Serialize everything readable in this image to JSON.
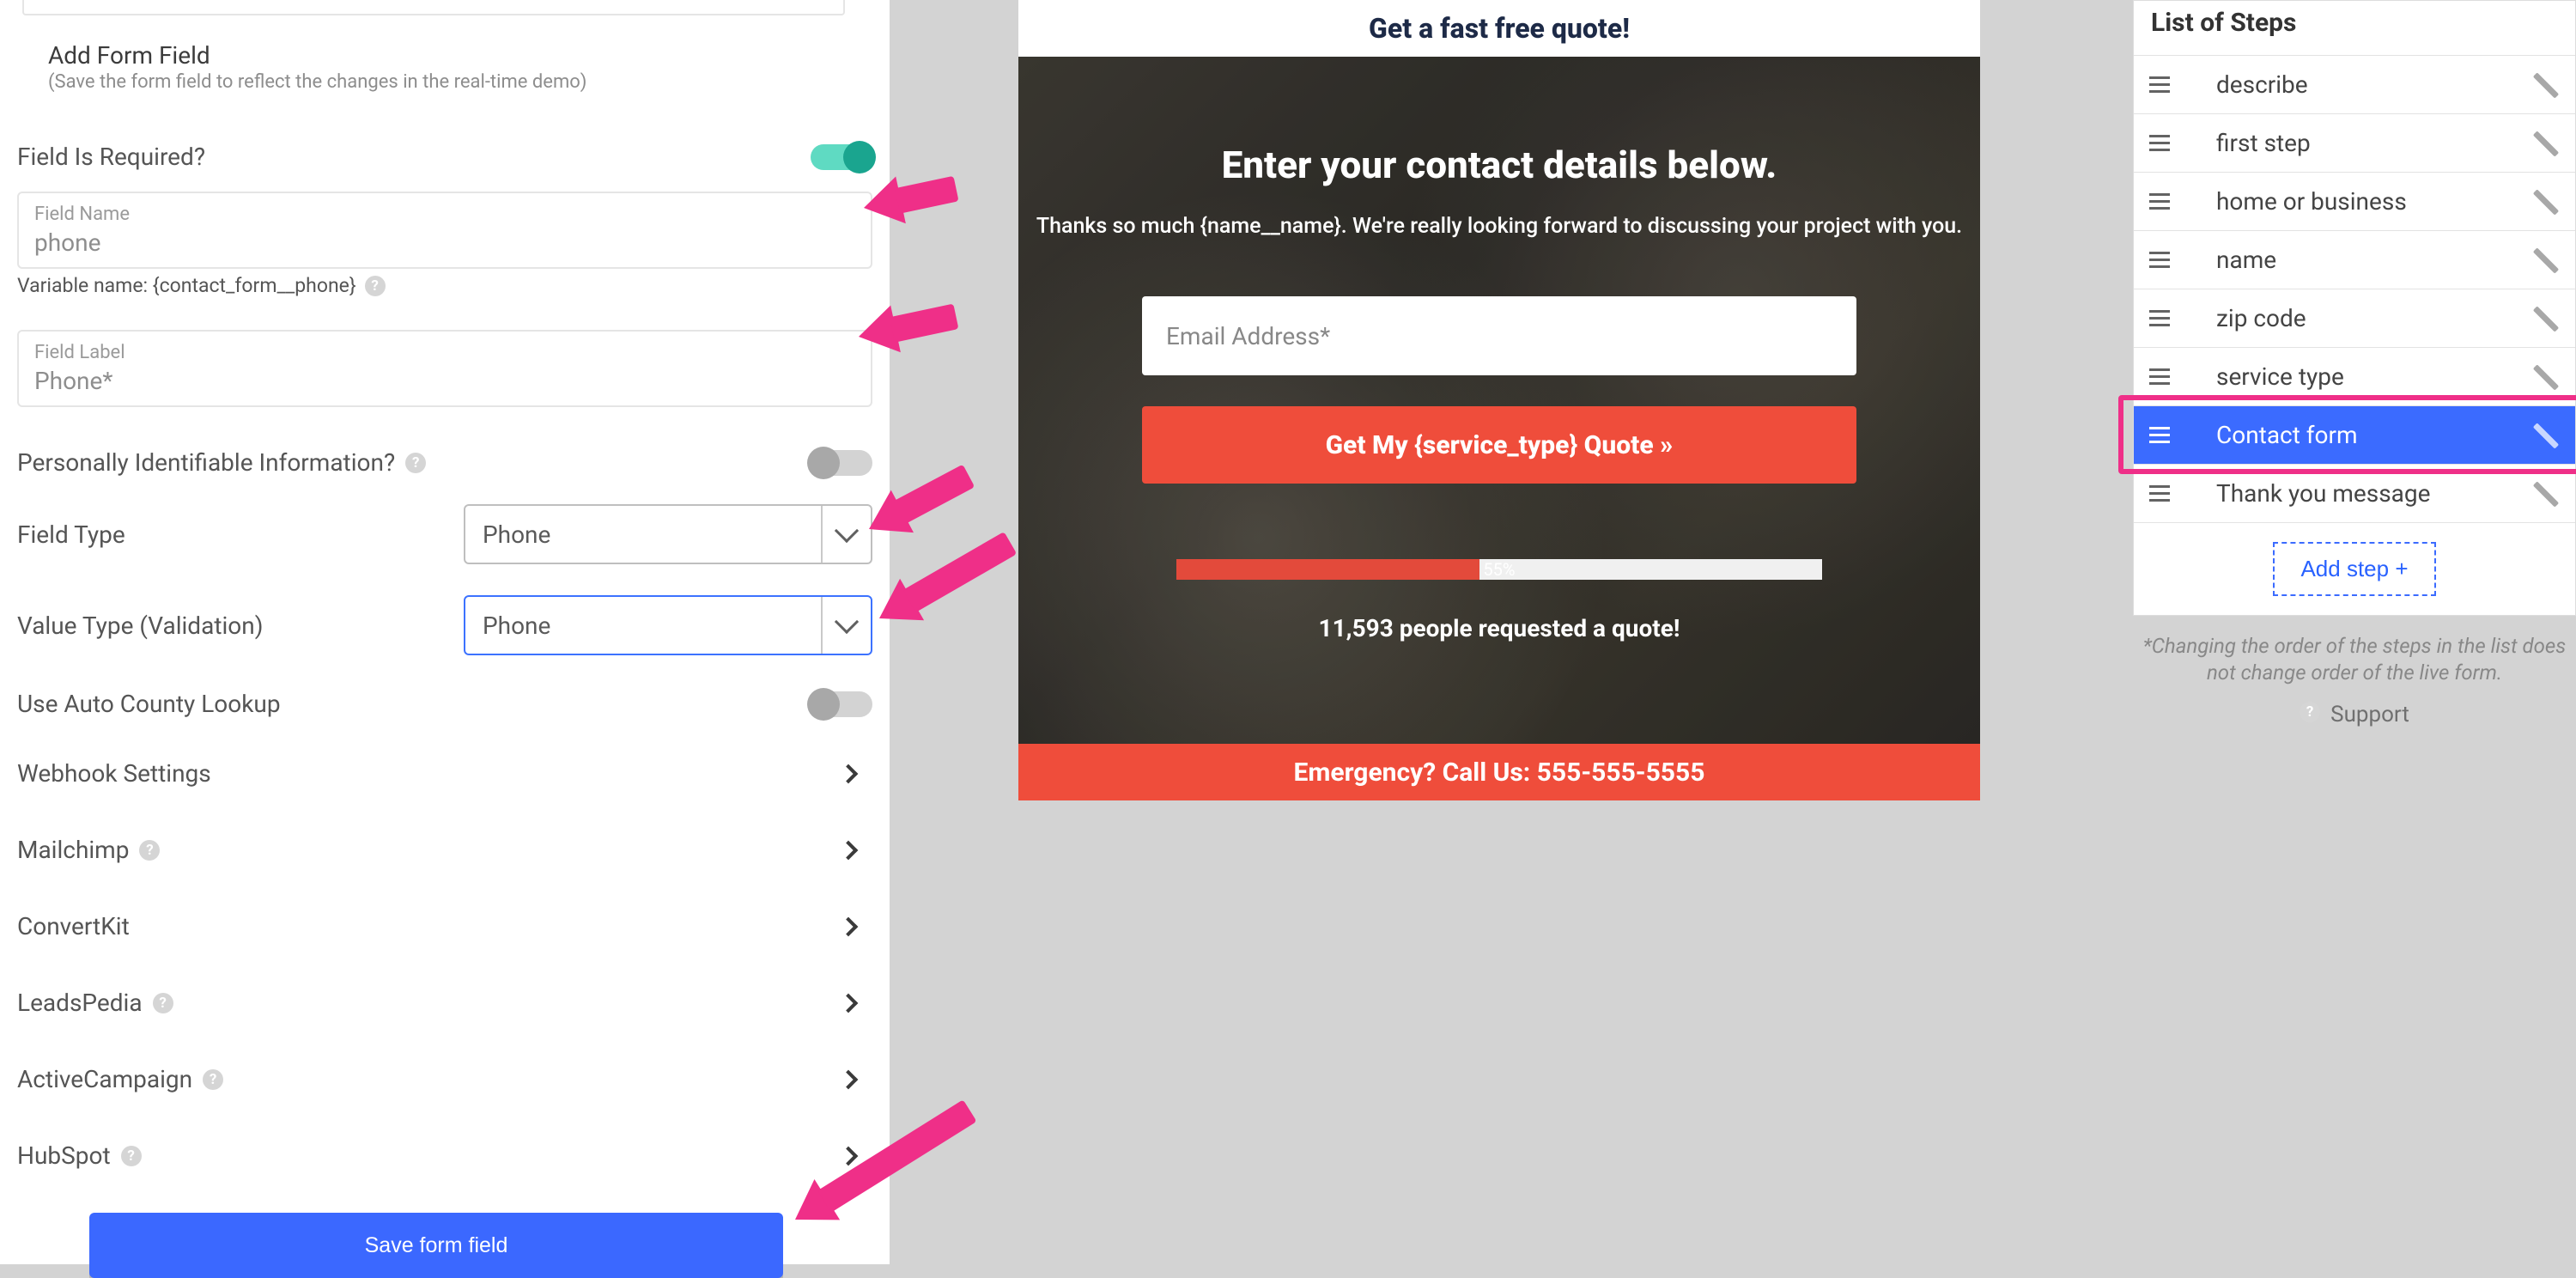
{
  "leftPanel": {
    "sectionTitle": "Add Form Field",
    "sectionSub": "(Save the form field to reflect the changes in the real-time demo)",
    "requiredLabel": "Field Is Required?",
    "requiredOn": true,
    "fieldName": {
      "label": "Field Name",
      "value": "phone"
    },
    "variableName": "Variable name: {contact_form__phone}",
    "fieldLabel": {
      "label": "Field Label",
      "value": "Phone*"
    },
    "piiLabel": "Personally Identifiable Information?",
    "piiOn": false,
    "fieldType": {
      "label": "Field Type",
      "value": "Phone"
    },
    "valueType": {
      "label": "Value Type (Validation)",
      "value": "Phone"
    },
    "autoCounty": {
      "label": "Use Auto County Lookup",
      "on": false
    },
    "settings": [
      {
        "label": "Webhook Settings",
        "help": false
      },
      {
        "label": "Mailchimp",
        "help": true
      },
      {
        "label": "ConvertKit",
        "help": false
      },
      {
        "label": "LeadsPedia",
        "help": true
      },
      {
        "label": "ActiveCampaign",
        "help": true
      },
      {
        "label": "HubSpot",
        "help": true
      }
    ],
    "saveBtn": "Save form field"
  },
  "preview": {
    "topBar": "Get a fast free quote!",
    "heading": "Enter your contact details below.",
    "subline": "Thanks so much {name__name}. We're really looking forward to discussing your project with you.",
    "emailPlaceholder": "Email Address*",
    "cta": "Get My {service_type} Quote »",
    "progressPct": "55%",
    "progressWidthPct": 47,
    "social": "11,593 people requested a quote!",
    "emergency": "Emergency? Call Us: 555-555-5555"
  },
  "steps": {
    "title": "List of Steps",
    "items": [
      "describe",
      "first step",
      "home or business",
      "name",
      "zip code",
      "service type",
      "Contact form",
      "Thank you message"
    ],
    "selectedIndex": 6,
    "addStep": "Add step +",
    "note": "*Changing the order of the steps in the list does not change order of the live form.",
    "support": "Support"
  }
}
